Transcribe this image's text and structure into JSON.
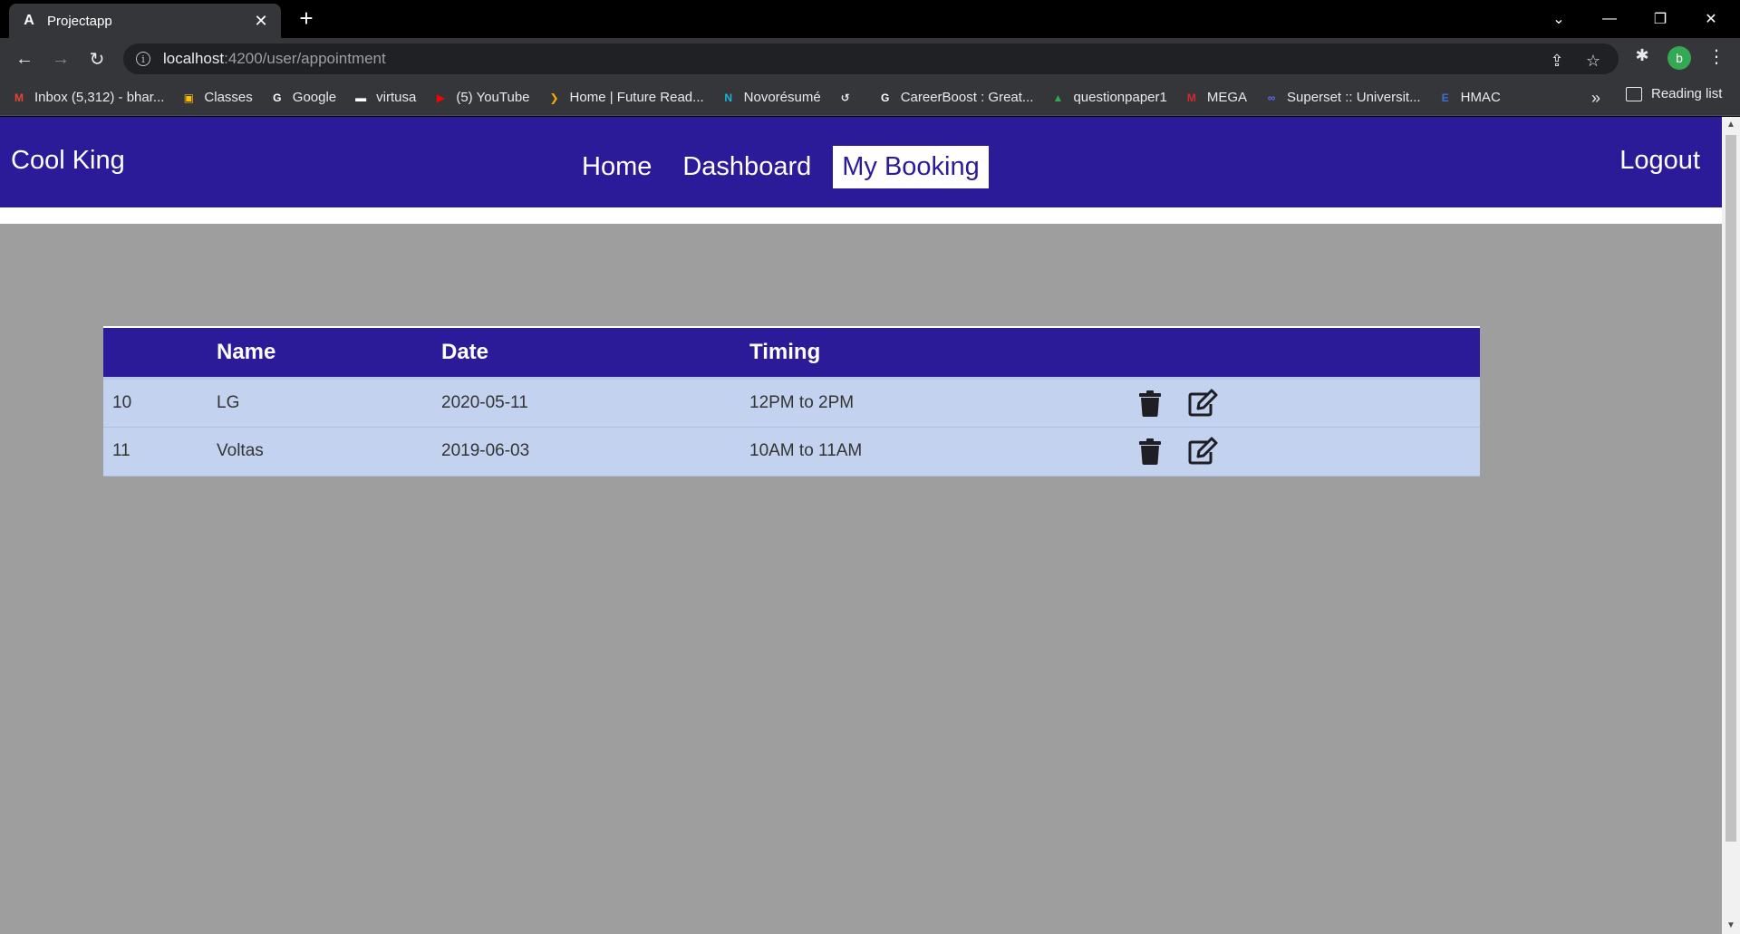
{
  "browser": {
    "tab_title": "Projectapp",
    "tab_favicon": "A",
    "url_host": "localhost",
    "url_path": ":4200/user/appointment",
    "profile_initial": "b",
    "bookmarks": [
      {
        "label": "Inbox (5,312) - bhar...",
        "icon": "gmail-icon",
        "color": "#ea4335",
        "glyph": "M"
      },
      {
        "label": "Classes",
        "icon": "classroom-icon",
        "color": "#fbbc04",
        "glyph": "▣"
      },
      {
        "label": "Google",
        "icon": "google-icon",
        "color": "#ffffff",
        "glyph": "G"
      },
      {
        "label": "virtusa",
        "icon": "virtusa-icon",
        "color": "#ffffff",
        "glyph": "▬"
      },
      {
        "label": "(5) YouTube",
        "icon": "youtube-icon",
        "color": "#ff0000",
        "glyph": "▶"
      },
      {
        "label": "Home | Future Read...",
        "icon": "future-ready-icon",
        "color": "#f9ab00",
        "glyph": "❯"
      },
      {
        "label": "Novorésumé",
        "icon": "novoresume-icon",
        "color": "#14b8d9",
        "glyph": "N"
      },
      {
        "label": "",
        "icon": "history-icon",
        "color": "#e8eaed",
        "glyph": "↺"
      },
      {
        "label": "CareerBoost : Great...",
        "icon": "google-icon",
        "color": "#ffffff",
        "glyph": "G"
      },
      {
        "label": "questionpaper1",
        "icon": "drive-icon",
        "color": "#34a853",
        "glyph": "▲"
      },
      {
        "label": "MEGA",
        "icon": "mega-icon",
        "color": "#d9272e",
        "glyph": "M"
      },
      {
        "label": "Superset :: Universit...",
        "icon": "superset-icon",
        "color": "#5b6cf5",
        "glyph": "∞"
      },
      {
        "label": "HMAC",
        "icon": "hmac-icon",
        "color": "#3c6fd1",
        "glyph": "E"
      }
    ],
    "more_label": "»",
    "reading_list_label": "Reading list"
  },
  "navbar": {
    "brand": "Cool King",
    "links": [
      "Home",
      "Dashboard",
      "My Booking"
    ],
    "active_link": "My Booking",
    "logout": "Logout"
  },
  "table": {
    "headers": [
      "",
      "Name",
      "Date",
      "Timing",
      ""
    ],
    "rows": [
      {
        "id": "10",
        "name": "LG",
        "date": "2020-05-11",
        "timing": "12PM to 2PM"
      },
      {
        "id": "11",
        "name": "Voltas",
        "date": "2019-06-03",
        "timing": "10AM to 11AM"
      }
    ]
  },
  "colors": {
    "navbar_bg": "#2c1b98",
    "page_bg": "#9e9e9e",
    "row_bg": "#c3d3ef"
  }
}
